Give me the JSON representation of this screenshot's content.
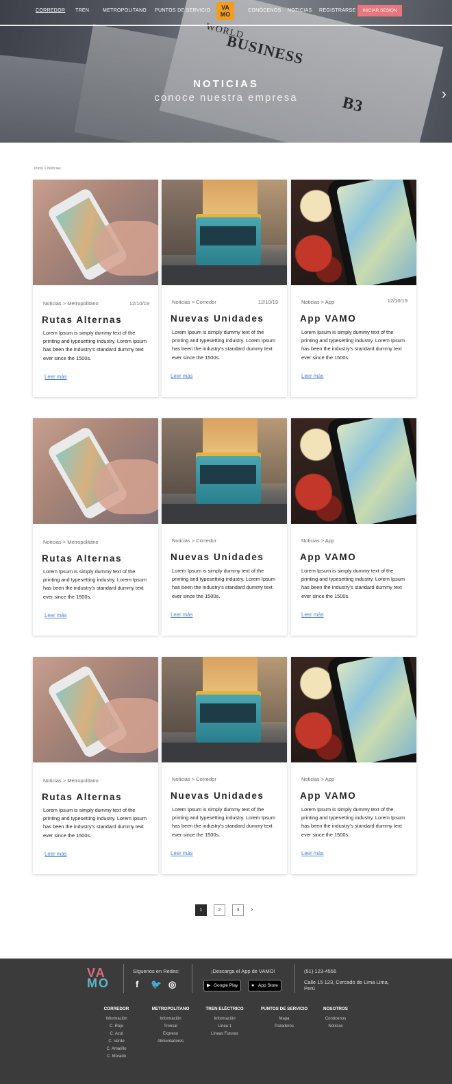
{
  "nav": {
    "items": [
      "CORREDOR",
      "TREN",
      "METROPOLITANO",
      "PUNTOS DE SERVICIO",
      "CONÓCENOS",
      "NOTICIAS",
      "REGISTRARSE"
    ],
    "logo_top": "VA",
    "logo_bottom": "MO",
    "login": "INICIAR SESIÓN"
  },
  "hero": {
    "title": "NOTICIAS",
    "subtitle": "conoce nuestra empresa",
    "next": "›"
  },
  "breadcrumb": "Inicio > Noticias",
  "cards": [
    {
      "category": "Noticias  > Metropolitano",
      "date": "12/10/19",
      "title": "Rutas Alternas",
      "text": "Lorem Ipsum is simply dummy text of the printing and typesetting industry. Lorem Ipsum has been the industry's standard dummy text ever since the 1500s.",
      "link": "Leer más"
    },
    {
      "category": "Noticias  > Corredor",
      "date": "12/10/19",
      "title": "Nuevas Unidades",
      "text": "Lorem Ipsum is simply dummy text of the printing and typesetting industry. Lorem Ipsum has been the industry's standard dummy text ever since the 1500s.",
      "link": "Leer más"
    },
    {
      "category": "Noticias  > App",
      "date": "12/10/19",
      "title": "App VAMO",
      "text": "Lorem Ipsum is simply dummy text of the printing and typesetting industry. Lorem Ipsum has been the industry's standard dummy text ever since the 1500s.",
      "link": "Leer más"
    },
    {
      "category": "Noticias  > Metropolitano",
      "date": "",
      "title": "Rutas Alternas",
      "text": "Lorem Ipsum is simply dummy text of the printing and typesetting industry. Lorem Ipsum has been the industry's standard dummy text ever since the 1500s.",
      "link": "Leer más"
    },
    {
      "category": "Noticias  > Corredor",
      "date": "",
      "title": "Nuevas Unidades",
      "text": "Lorem Ipsum is simply dummy text of the printing and typesetting industry. Lorem Ipsum has been the industry's standard dummy text ever since the 1500s.",
      "link": "Leer más"
    },
    {
      "category": "Noticias  > App",
      "date": "",
      "title": "App VAMO",
      "text": "Lorem Ipsum is simply dummy text of the printing and typesetting industry. Lorem Ipsum has been the industry's standard dummy text ever since the 1500s.",
      "link": "Leer más"
    },
    {
      "category": "Noticias  > Metropolitano",
      "date": "",
      "title": "Rutas Alternas",
      "text": "Lorem Ipsum is simply dummy text of the printing and typesetting industry. Lorem Ipsum has been the industry's standard dummy text ever since the 1500s.",
      "link": "Leer más"
    },
    {
      "category": "Noticias  > Corredor",
      "date": "",
      "title": "Nuevas Unidades",
      "text": "Lorem Ipsum is simply dummy text of the printing and typesetting industry. Lorem Ipsum has been the industry's standard dummy text ever since the 1500s.",
      "link": "Leer más"
    },
    {
      "category": "Noticias  > App",
      "date": "",
      "title": "App VAMO",
      "text": "Lorem Ipsum is simply dummy text of the printing and typesetting industry. Lorem Ipsum has been the industry's standard dummy text ever since the 1500s.",
      "link": "Leer más"
    }
  ],
  "pagination": {
    "pages": [
      "1",
      "2",
      "3"
    ],
    "current": "1",
    "next": "›"
  },
  "footer": {
    "logo_top": "VA",
    "logo_bottom": "MO",
    "follow": "Síguenos en Redes:",
    "social": [
      "f",
      "🐦",
      "◎"
    ],
    "social_icons": [
      "facebook-icon",
      "twitter-icon",
      "instagram-icon"
    ],
    "app_title": "¡Descarga el App de VAMO!",
    "google_play": "Google Play",
    "app_store": "App Store",
    "phone": "(51) 123-4556",
    "address": "Calle 15 123, Cercado de Lima Lima, Perú",
    "columns": [
      {
        "heading": "CORREDOR",
        "items": [
          "Información",
          "C. Rojo",
          "C. Azul",
          "C. Verde",
          "C. Amarillo",
          "C. Morado"
        ]
      },
      {
        "heading": "METROPOLITANO",
        "items": [
          "Información",
          "Troncal",
          "Expreso",
          "Alimentadores"
        ]
      },
      {
        "heading": "TREN ELÉCTRICO",
        "items": [
          "Información",
          "Línea 1",
          "Líneas Futuras"
        ]
      },
      {
        "heading": "PUNTOS DE SERVICIO",
        "items": [
          "Mapa",
          "Paraderos"
        ]
      },
      {
        "heading": "NOSOTROS",
        "items": [
          "Conócenos",
          "Noticias"
        ]
      }
    ]
  },
  "colors": {
    "accent": "#e8767c",
    "logo_orange": "#f29d1b",
    "link": "#4a7fd6",
    "footer_bg": "#3b3b3b"
  }
}
